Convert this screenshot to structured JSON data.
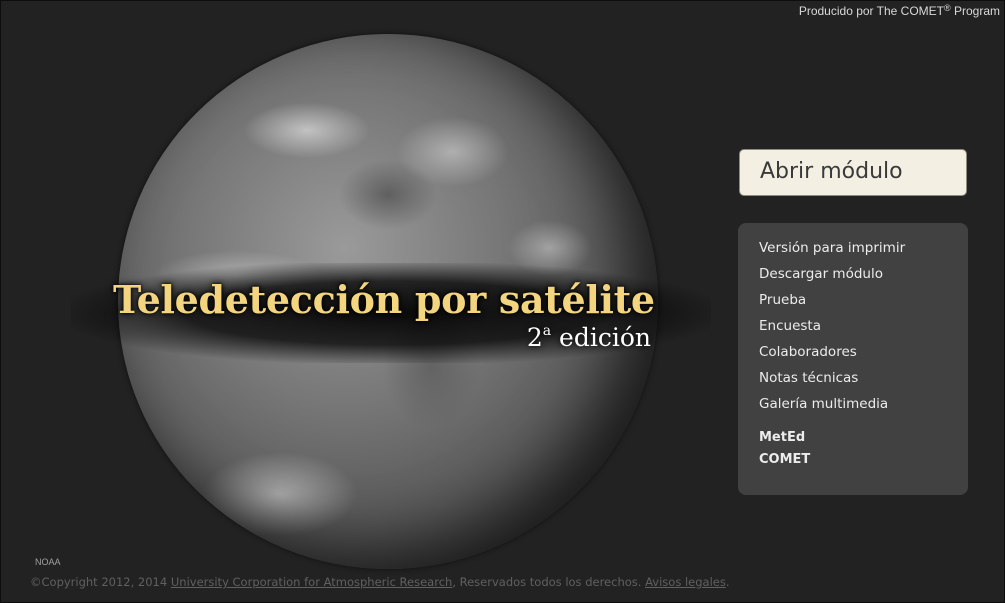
{
  "header": {
    "producer_prefix": "Producido por The COMET",
    "producer_mark": "®",
    "producer_suffix": " Program"
  },
  "module": {
    "title": "Teledetección por satélite",
    "edition_number": "2",
    "edition_super": "a",
    "edition_label": " edición",
    "open_button": "Abrir módulo",
    "image_credit": "NOAA"
  },
  "menu": {
    "items": [
      {
        "label": "Versión para imprimir"
      },
      {
        "label": "Descargar módulo"
      },
      {
        "label": "Prueba"
      },
      {
        "label": "Encuesta"
      },
      {
        "label": "Colaboradores"
      },
      {
        "label": "Notas técnicas"
      },
      {
        "label": "Galería multimedia"
      }
    ],
    "links": [
      {
        "label": "MetEd"
      },
      {
        "label": "COMET"
      }
    ]
  },
  "footer": {
    "copyright": "©Copyright 2012, 2014 ",
    "org_link": "University Corporation for Atmospheric Research",
    "rights": ", Reservados todos los derechos. ",
    "legal_link": "Avisos legales",
    "end": "."
  },
  "colors": {
    "background": "#222222",
    "title_gold": "#f3d47f",
    "panel": "#414141",
    "button": "#f3efe2"
  }
}
